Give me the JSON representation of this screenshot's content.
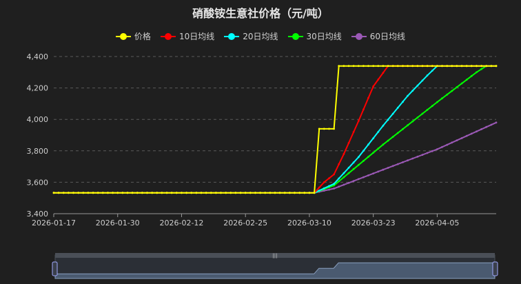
{
  "title": "硝酸铵生意社价格（元/吨）",
  "chart_data": {
    "type": "line",
    "title": "硝酸铵生意社价格（元/吨）",
    "x_ticks": [
      "2026-01-17",
      "2026-01-30",
      "2026-02-12",
      "2026-02-25",
      "2026-03-10",
      "2026-03-23",
      "2026-04-05"
    ],
    "x_range": [
      "2026-01-17",
      "2026-04-17"
    ],
    "ylim": [
      3400,
      4400
    ],
    "y_ticks": [
      "3,400",
      "3,600",
      "3,800",
      "4,000",
      "4,200",
      "4,400"
    ],
    "grid": true,
    "legend_position": "top",
    "series": [
      {
        "name": "价格",
        "color": "#ffff00",
        "points": [
          [
            "2026-01-17",
            3533
          ],
          [
            "2026-03-10",
            3533
          ],
          [
            "2026-03-11",
            3533
          ],
          [
            "2026-03-12",
            3940
          ],
          [
            "2026-03-15",
            3940
          ],
          [
            "2026-03-16",
            4340
          ],
          [
            "2026-04-17",
            4340
          ]
        ]
      },
      {
        "name": "10日均线",
        "color": "#ff0000",
        "points": [
          [
            "2026-01-17",
            3533
          ],
          [
            "2026-03-11",
            3533
          ],
          [
            "2026-03-13",
            3600
          ],
          [
            "2026-03-15",
            3650
          ],
          [
            "2026-03-17",
            3780
          ],
          [
            "2026-03-20",
            3990
          ],
          [
            "2026-03-23",
            4210
          ],
          [
            "2026-03-26",
            4340
          ],
          [
            "2026-04-17",
            4340
          ]
        ]
      },
      {
        "name": "20日均线",
        "color": "#00ffff",
        "points": [
          [
            "2026-01-17",
            3533
          ],
          [
            "2026-03-11",
            3533
          ],
          [
            "2026-03-15",
            3590
          ],
          [
            "2026-03-20",
            3760
          ],
          [
            "2026-03-25",
            3960
          ],
          [
            "2026-03-30",
            4150
          ],
          [
            "2026-04-03",
            4280
          ],
          [
            "2026-04-05",
            4340
          ],
          [
            "2026-04-17",
            4340
          ]
        ]
      },
      {
        "name": "30日均线",
        "color": "#00ff00",
        "points": [
          [
            "2026-01-17",
            3533
          ],
          [
            "2026-03-11",
            3533
          ],
          [
            "2026-03-15",
            3580
          ],
          [
            "2026-03-25",
            3840
          ],
          [
            "2026-04-05",
            4110
          ],
          [
            "2026-04-13",
            4300
          ],
          [
            "2026-04-15",
            4340
          ],
          [
            "2026-04-17",
            4340
          ]
        ]
      },
      {
        "name": "60日均线",
        "color": "#9b59b6",
        "points": [
          [
            "2026-01-17",
            3533
          ],
          [
            "2026-03-11",
            3533
          ],
          [
            "2026-03-15",
            3560
          ],
          [
            "2026-03-25",
            3680
          ],
          [
            "2026-04-05",
            3810
          ],
          [
            "2026-04-17",
            3980
          ]
        ]
      }
    ]
  },
  "data_zoom": {
    "start_percent": 0,
    "end_percent": 100
  }
}
